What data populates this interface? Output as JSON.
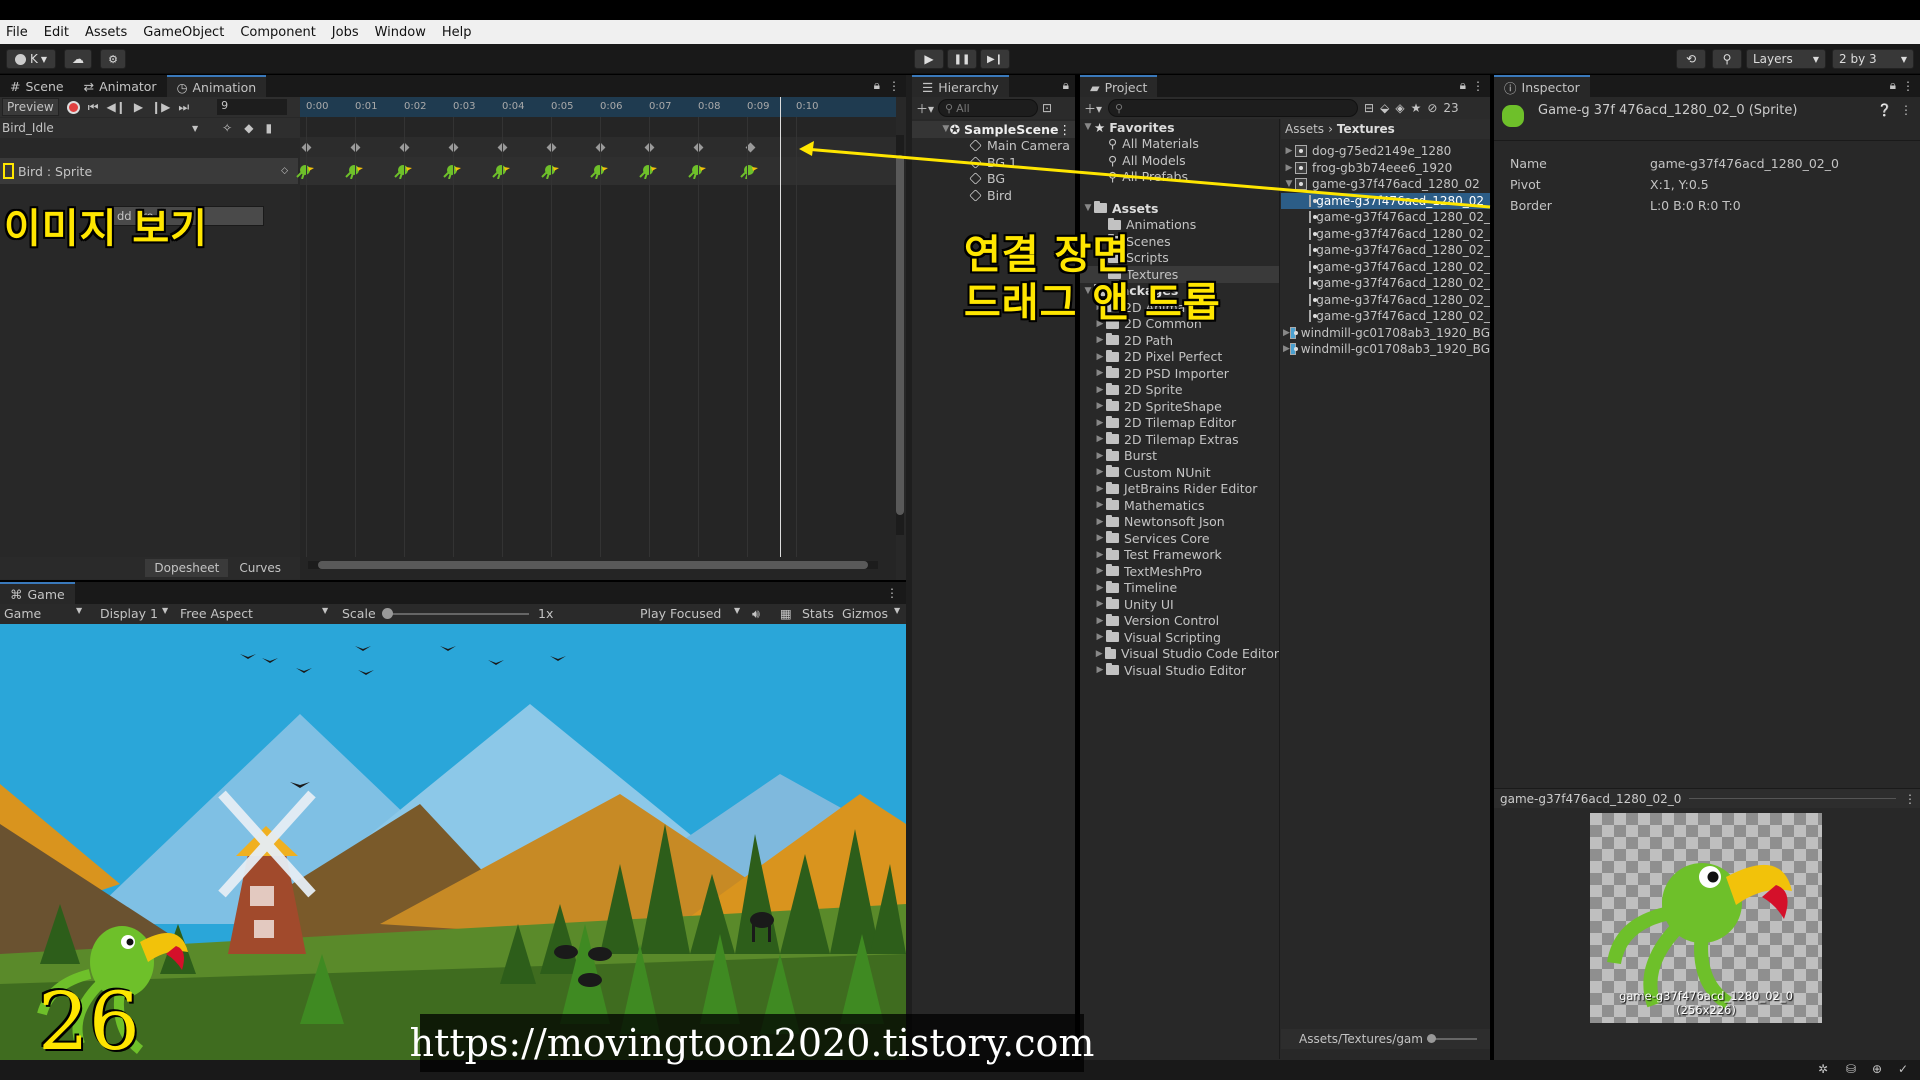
{
  "menubar": [
    "File",
    "Edit",
    "Assets",
    "GameObject",
    "Component",
    "Jobs",
    "Window",
    "Help"
  ],
  "toolbar": {
    "account": "K",
    "layers_label": "Layers",
    "layout_label": "2 by 3"
  },
  "anim_panel": {
    "tabs": [
      "Scene",
      "Animator",
      "Animation"
    ],
    "preview_label": "Preview",
    "frame_value": "9",
    "clip_name": "Bird_Idle",
    "property_label": "Bird : Sprite",
    "add_property_label": "dd Pro",
    "dopesheet_label": "Dopesheet",
    "curves_label": "Curves",
    "ruler": [
      "0:00",
      "0:01",
      "0:02",
      "0:03",
      "0:04",
      "0:05",
      "0:06",
      "0:07",
      "0:08",
      "0:09",
      "0:10"
    ],
    "keyframe_count": 10
  },
  "game_panel": {
    "tab": "Game",
    "game_dropdown": "Game",
    "display": "Display 1",
    "aspect": "Free Aspect",
    "scale_label": "Scale",
    "scale_value": "1x",
    "play_focused": "Play Focused",
    "stats": "Stats",
    "gizmos": "Gizmos"
  },
  "hierarchy": {
    "tab": "Hierarchy",
    "search_placeholder": "All",
    "scene": "SampleScene",
    "items": [
      "Main Camera",
      "BG 1",
      "BG",
      "Bird"
    ]
  },
  "project": {
    "tab": "Project",
    "badge": "23",
    "favorites_label": "Favorites",
    "favorites": [
      "All Materials",
      "All Models",
      "All Prefabs"
    ],
    "assets_label": "Assets",
    "asset_folders": [
      "Animations",
      "Scenes",
      "Scripts",
      "Textures"
    ],
    "packages_label": "Packages",
    "packages": [
      "2D Animation",
      "2D Common",
      "2D Path",
      "2D Pixel Perfect",
      "2D PSD Importer",
      "2D Sprite",
      "2D SpriteShape",
      "2D Tilemap Editor",
      "2D Tilemap Extras",
      "Burst",
      "Custom NUnit",
      "JetBrains Rider Editor",
      "Mathematics",
      "Newtonsoft Json",
      "Services Core",
      "Test Framework",
      "TextMeshPro",
      "Timeline",
      "Unity UI",
      "Version Control",
      "Visual Scripting",
      "Visual Studio Code Editor",
      "Visual Studio Editor"
    ],
    "breadcrumb": [
      "Assets",
      "Textures"
    ],
    "files": [
      {
        "name": "dog-g75ed2149e_1280",
        "indent": 0
      },
      {
        "name": "frog-gb3b74eee6_1920",
        "indent": 0
      },
      {
        "name": "game-g37f476acd_1280_02",
        "indent": 0
      },
      {
        "name": "game-g37f476acd_1280_02_",
        "indent": 1
      },
      {
        "name": "game-g37f476acd_1280_02_",
        "indent": 1
      },
      {
        "name": "game-g37f476acd_1280_02_",
        "indent": 1
      },
      {
        "name": "game-g37f476acd_1280_02_",
        "indent": 1
      },
      {
        "name": "game-g37f476acd_1280_02_",
        "indent": 1
      },
      {
        "name": "game-g37f476acd_1280_02_",
        "indent": 1
      },
      {
        "name": "game-g37f476acd_1280_02_",
        "indent": 1
      },
      {
        "name": "game-g37f476acd_1280_02_",
        "indent": 1
      },
      {
        "name": "windmill-gc01708ab3_1920_BG",
        "indent": 0
      },
      {
        "name": "windmill-gc01708ab3_1920_BG",
        "indent": 0
      }
    ],
    "footer_path": "Assets/Textures/gam"
  },
  "inspector": {
    "tab": "Inspector",
    "title": "Game-g 37f 476acd_1280_02_0 (Sprite)",
    "fields": [
      {
        "label": "Name",
        "value": "game-g37f476acd_1280_02_0"
      },
      {
        "label": "Pivot",
        "value": "X:1, Y:0.5"
      },
      {
        "label": "Border",
        "value": "L:0 B:0 R:0 T:0"
      }
    ],
    "preview_header": "game-g37f476acd_1280_02_0",
    "preview_caption": "game-g37f476acd_1280_02_0",
    "preview_size": "(256x226)"
  },
  "overlay": {
    "view_image": "이미지 보기",
    "link_scene": "연결 장면",
    "drag_drop": "드래그 앤 드롭",
    "episode": "26",
    "url": "https://movingtoon2020.tistory.com"
  },
  "colors": {
    "accent": "#3a79bb",
    "annotation": "#ffe600",
    "sky": "#2aa6d9",
    "record": "#e04040"
  }
}
